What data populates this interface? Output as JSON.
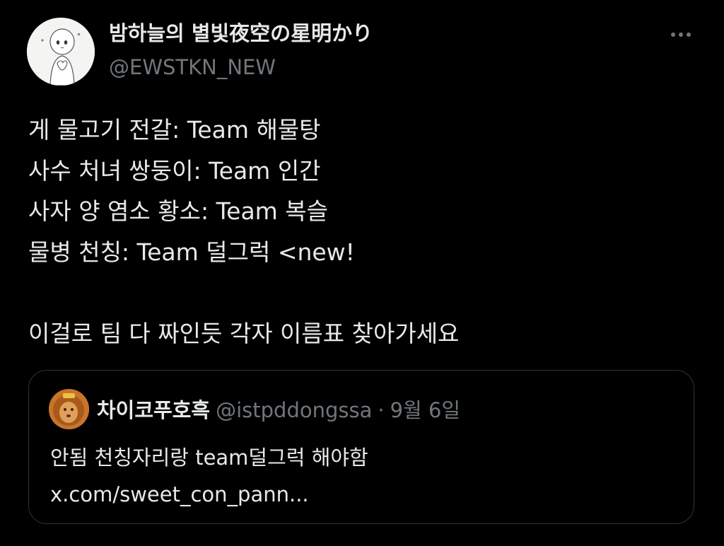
{
  "tweet": {
    "author": {
      "display_name": "밤하늘의 별빛夜空の星明かり",
      "handle": "@EWSTKN_NEW",
      "avatar_icon": "avatar-image"
    },
    "more_icon": "more-horizontal-icon",
    "body_lines": [
      "게 물고기 전갈: Team 해물탕",
      "사수 처녀 쌍둥이: Team 인간",
      "사자 양 염소 황소: Team 복슬",
      "물병 천칭: Team 덜그럭 <new!",
      "",
      "이걸로 팀 다 짜인듯 각자 이름표 찾아가세요"
    ],
    "quoted": {
      "display_name": "차이코푸호흑",
      "handle": "@istpddongssa",
      "separator": "·",
      "date": "9월 6일",
      "avatar_icon": "lion-avatar-image",
      "text_lines": [
        "안됨 천칭자리랑 team덜그럭 해야함",
        "x.com/sweet_con_pann..."
      ]
    }
  },
  "colors": {
    "background": "#000000",
    "primary_text": "#e7e9ea",
    "secondary_text": "#71767b",
    "border": "#2f3336"
  }
}
